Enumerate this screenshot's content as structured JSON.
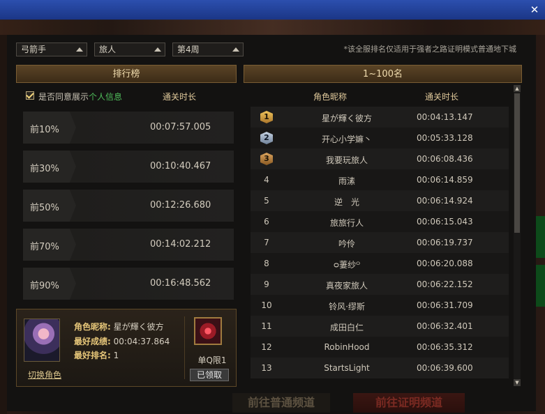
{
  "window": {
    "close_glyph": "✕"
  },
  "filters": {
    "class": "弓箭手",
    "subclass": "旅人",
    "week": "第4周"
  },
  "notice": "*该全服排名仅适用于强者之路证明模式普通地下城",
  "left_panel": {
    "title": "排行榜",
    "consent_label": "是否同意展示",
    "consent_link": "个人信息",
    "col_time": "通关时长",
    "tiers": [
      {
        "label": "前10%",
        "time": "00:07:57.005"
      },
      {
        "label": "前30%",
        "time": "00:10:40.467"
      },
      {
        "label": "前50%",
        "time": "00:12:26.680"
      },
      {
        "label": "前70%",
        "time": "00:14:02.212"
      },
      {
        "label": "前90%",
        "time": "00:16:48.562"
      }
    ]
  },
  "my_info": {
    "name_key": "角色昵称:",
    "name_val": "星が輝く彼方",
    "best_key": "最好成绩:",
    "best_val": "00:04:37.864",
    "rank_key": "最好排名:",
    "rank_val": "1",
    "switch_label": "切换角色",
    "reward_label": "单Q限1",
    "claimed_label": "已领取"
  },
  "right_panel": {
    "title": "1~100名",
    "col_name": "角色昵称",
    "col_time": "通关时长",
    "rows": [
      {
        "rank": "1",
        "name": "星が輝く彼方",
        "time": "00:04:13.147"
      },
      {
        "rank": "2",
        "name": "开心小学嫲丶",
        "time": "00:05:33.128"
      },
      {
        "rank": "3",
        "name": "我要玩旅人",
        "time": "00:06:08.436"
      },
      {
        "rank": "4",
        "name": "雨溸",
        "time": "00:06:14.859"
      },
      {
        "rank": "5",
        "name": "逆　光",
        "time": "00:06:14.924"
      },
      {
        "rank": "6",
        "name": "旅旅行人",
        "time": "00:06:15.043"
      },
      {
        "rank": "7",
        "name": "吟伶",
        "time": "00:06:19.737"
      },
      {
        "rank": "8",
        "name": "ᴑ萋纱ᴼ",
        "time": "00:06:20.088"
      },
      {
        "rank": "9",
        "name": "真夜家旅人",
        "time": "00:06:22.152"
      },
      {
        "rank": "10",
        "name": "铃风·缪斯",
        "time": "00:06:31.709"
      },
      {
        "rank": "11",
        "name": "成田白仁",
        "time": "00:06:32.401"
      },
      {
        "rank": "12",
        "name": "RobinHood",
        "time": "00:06:35.312"
      },
      {
        "rank": "13",
        "name": "StartsLight",
        "time": "00:06:39.600"
      }
    ]
  },
  "bottom": {
    "normal_label": "前往普通频道",
    "cert_label": "前往证明频道"
  }
}
